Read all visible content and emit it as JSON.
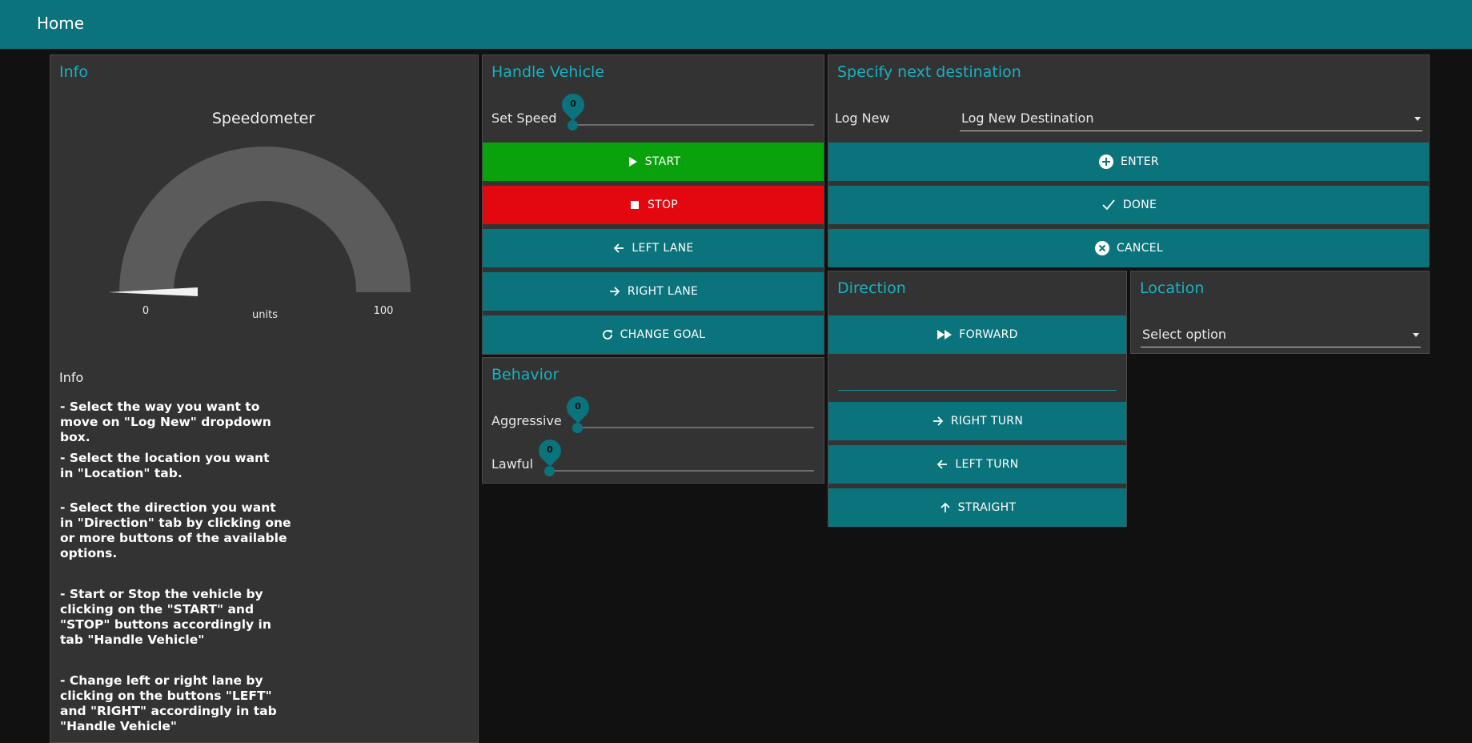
{
  "header": {
    "title": "Home"
  },
  "info_panel": {
    "title": "Info",
    "gauge": {
      "title": "Speedometer",
      "min_label": "0",
      "max_label": "100",
      "units": "units",
      "value": 0,
      "min": 0,
      "max": 100
    },
    "info_heading": "Info",
    "instructions": [
      "- Select the way you want to move on \"Log New\" dropdown box.",
      "- Select the location you want in \"Location\" tab.",
      "- Select the direction you want in \"Direction\" tab by clicking one or more buttons of the available options.",
      "- Start or Stop the vehicle by clicking on the \"START\" and \"STOP\" buttons accordingly in tab \"Handle Vehicle\"",
      "- Change left or right lane by clicking on the buttons \"LEFT\" and \"RIGHT\" accordingly in tab \"Handle Vehicle\""
    ]
  },
  "handle_vehicle": {
    "title": "Handle Vehicle",
    "set_speed_label": "Set Speed",
    "set_speed_value": "0",
    "buttons": {
      "start": "START",
      "stop": "STOP",
      "left_lane": "LEFT LANE",
      "right_lane": "RIGHT LANE",
      "change_goal": "CHANGE GOAL"
    }
  },
  "behavior": {
    "title": "Behavior",
    "aggressive_label": "Aggressive",
    "aggressive_value": "0",
    "lawful_label": "Lawful",
    "lawful_value": "0"
  },
  "destination": {
    "title": "Specify next destination",
    "log_new_label": "Log New",
    "log_new_selected": "Log New Destination",
    "buttons": {
      "enter": "ENTER",
      "done": "DONE",
      "cancel": "CANCEL"
    }
  },
  "direction": {
    "title": "Direction",
    "input_value": "",
    "buttons": {
      "forward": "FORWARD",
      "right_turn": "RIGHT TURN",
      "left_turn": "LEFT TURN",
      "straight": "STRAIGHT"
    }
  },
  "location": {
    "title": "Location",
    "selected": "Select option"
  },
  "colors": {
    "accent": "#0b737b",
    "title_text": "#16b2c1",
    "start": "#09a10c",
    "stop": "#e3080f",
    "panel": "#333333",
    "background": "#111111",
    "gauge_fill": "#5b5b5b"
  }
}
